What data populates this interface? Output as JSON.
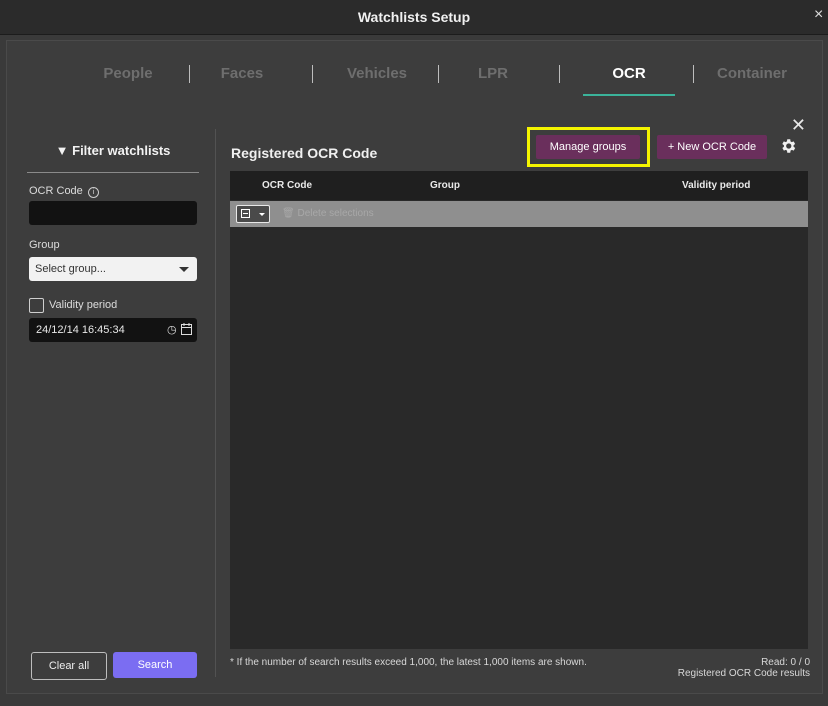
{
  "window": {
    "title": "Watchlists Setup",
    "close_glyph": "×"
  },
  "tabs": [
    {
      "label": "People"
    },
    {
      "label": "Faces"
    },
    {
      "label": "Vehicles"
    },
    {
      "label": "LPR"
    },
    {
      "label": "OCR",
      "active": true
    },
    {
      "label": "Container"
    }
  ],
  "content_close_glyph": "✕",
  "filter": {
    "heading": "Filter watchlists",
    "ocr_code_label": "OCR Code",
    "ocr_code_value": "",
    "group_label": "Group",
    "group_placeholder": "Select group...",
    "validity_label": "Validity period",
    "validity_checked": false,
    "date_value": "24/12/14 16:45:34",
    "clear_label": "Clear all",
    "search_label": "Search"
  },
  "main": {
    "title": "Registered OCR Code",
    "manage_groups_label": "Manage groups",
    "new_ocr_label": "+ New OCR Code",
    "highlight_color": "#f5f500"
  },
  "table": {
    "columns": [
      "OCR Code",
      "Group",
      "Validity period"
    ],
    "rows": [],
    "delete_selections_label": "Delete selections"
  },
  "footer": {
    "note": "* If the number of search results exceed 1,000, the latest 1,000 items are shown.",
    "read_label": "Read: 0 / 0",
    "results_label": "Registered OCR Code results"
  },
  "colors": {
    "accent_tab": "#3bb39a",
    "search_button": "#7b6df2",
    "action_buttons": "#6a2f5c"
  }
}
